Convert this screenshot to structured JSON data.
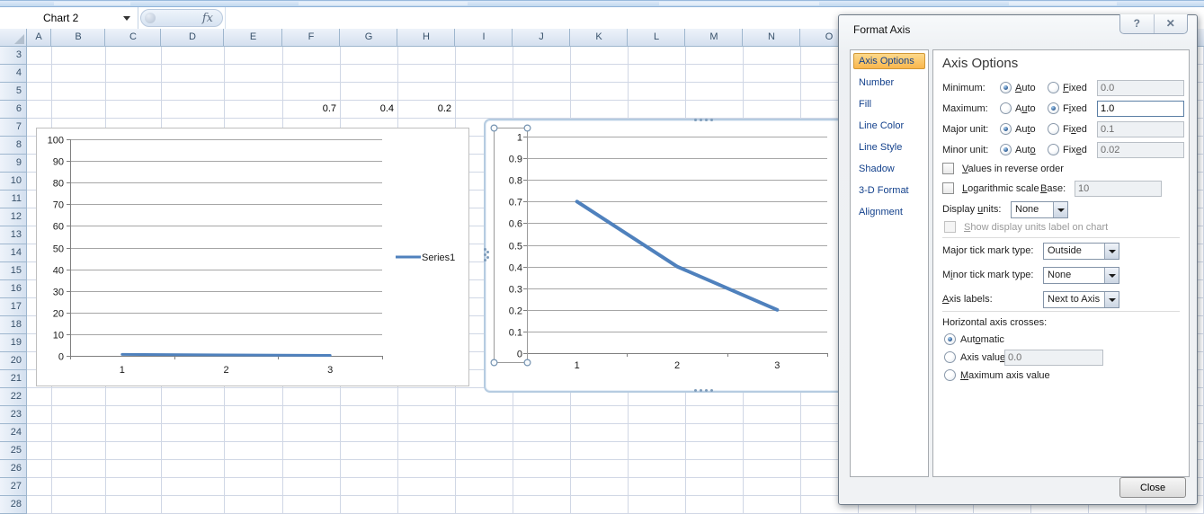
{
  "formula_bar": {
    "name_box": "Chart 2",
    "fx_label": "fx"
  },
  "sheet": {
    "columns": [
      "A",
      "B",
      "C",
      "D",
      "E",
      "F",
      "G",
      "H",
      "I",
      "J",
      "K",
      "L",
      "M",
      "N",
      "O"
    ],
    "rows": [
      3,
      4,
      5,
      6,
      7,
      8,
      9,
      10,
      11,
      12,
      13,
      14,
      15,
      16,
      17,
      18,
      19,
      20,
      21,
      22,
      23,
      24,
      25,
      26,
      27,
      28
    ],
    "cells": [
      {
        "ref": "F6",
        "col": "F",
        "row": 6,
        "value": "0.7"
      },
      {
        "ref": "G6",
        "col": "G",
        "row": 6,
        "value": "0.4"
      },
      {
        "ref": "H6",
        "col": "H",
        "row": 6,
        "value": "0.2"
      }
    ]
  },
  "chart_data": [
    {
      "type": "line",
      "title": "",
      "categories": [
        "1",
        "2",
        "3"
      ],
      "series": [
        {
          "name": "Series1",
          "values": [
            0.7,
            0.4,
            0.2
          ]
        }
      ],
      "ylim": [
        0,
        100
      ],
      "ytick_step": 10,
      "yticks": [
        "0",
        "10",
        "20",
        "30",
        "40",
        "50",
        "60",
        "70",
        "80",
        "90",
        "100"
      ],
      "grid": "horizontal",
      "legend": {
        "position": "right",
        "entries": [
          "Series1"
        ]
      },
      "line_color": "#4f81bd"
    },
    {
      "type": "line",
      "title": "",
      "categories": [
        "1",
        "2",
        "3"
      ],
      "series": [
        {
          "name": "Series1",
          "values": [
            0.7,
            0.4,
            0.2
          ]
        }
      ],
      "ylim": [
        0,
        1
      ],
      "ytick_step": 0.1,
      "yticks": [
        "0",
        "0.1",
        "0.2",
        "0.3",
        "0.4",
        "0.5",
        "0.6",
        "0.7",
        "0.8",
        "0.9",
        "1"
      ],
      "grid": "horizontal",
      "legend": {
        "position": "none",
        "entries": []
      },
      "line_color": "#4f81bd",
      "selected": true,
      "value_axis_selected": true
    }
  ],
  "dialog": {
    "title": "Format Axis",
    "help_glyph": "?",
    "close_glyph": "✕",
    "categories": [
      {
        "label": "Axis Options",
        "selected": true
      },
      {
        "label": "Number",
        "selected": false
      },
      {
        "label": "Fill",
        "selected": false
      },
      {
        "label": "Line Color",
        "selected": false
      },
      {
        "label": "Line Style",
        "selected": false
      },
      {
        "label": "Shadow",
        "selected": false
      },
      {
        "label": "3-D Format",
        "selected": false
      },
      {
        "label": "Alignment",
        "selected": false
      }
    ],
    "panel": {
      "header": "Axis Options",
      "param_rows": [
        {
          "label": "Minimum:",
          "auto_label": "&Auto",
          "fixed_label": "&Fixed",
          "mode": "auto",
          "value": "0.0",
          "value_enabled": false
        },
        {
          "label": "Maximum:",
          "auto_label": "A&uto",
          "fixed_label": "F&ixed",
          "mode": "fixed",
          "value": "1.0",
          "value_enabled": true
        },
        {
          "label": "Major unit:",
          "auto_label": "Au&to",
          "fixed_label": "Fi&xed",
          "mode": "auto",
          "value": "0.1",
          "value_enabled": false
        },
        {
          "label": "Minor unit:",
          "auto_label": "Aut&o",
          "fixed_label": "Fix&ed",
          "mode": "auto",
          "value": "0.02",
          "value_enabled": false
        }
      ],
      "reverse_label": "&Values in reverse order",
      "reverse_checked": false,
      "log_label": "&Logarithmic scale",
      "log_checked": false,
      "base_label": "&Base:",
      "base_value": "10",
      "display_units_label": "Display &units:",
      "display_units_value": "None",
      "show_units_label": "&Show display units label on chart",
      "show_units_checked": false,
      "major_tick_label": "Ma&jor tick mark type:",
      "major_tick_value": "Outside",
      "minor_tick_label": "M&inor tick mark type:",
      "minor_tick_value": "None",
      "axis_labels_label": "&Axis labels:",
      "axis_labels_value": "Next to Axis",
      "crosses_label": "Horizontal axis crosses:",
      "crosses_options": [
        {
          "label": "Aut&omatic",
          "selected": true
        },
        {
          "label": "Axis valu&e:",
          "selected": false,
          "value": "0.0",
          "value_enabled": false
        },
        {
          "label": "&Maximum axis value",
          "selected": false
        }
      ],
      "close_label": "Close"
    }
  }
}
